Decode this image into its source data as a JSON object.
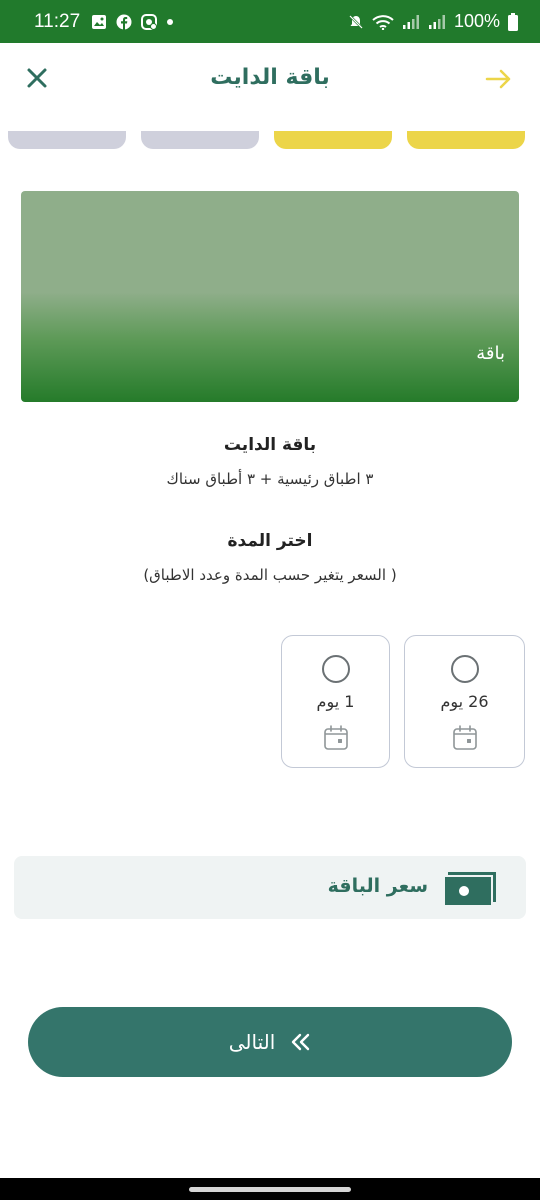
{
  "status_bar": {
    "time": "11:27",
    "battery": "100%"
  },
  "header": {
    "title": "باقة الدايت"
  },
  "progress": {
    "segments": 4,
    "completed": 2,
    "colors": {
      "done": "#ecd549",
      "pending": "#cfd0dc"
    }
  },
  "banner": {
    "label": "باقة"
  },
  "package": {
    "title": "باقة الدايت",
    "description": "٣ اطباق رئيسية + ٣ أطباق سناك"
  },
  "duration": {
    "title": "اختر المدة",
    "note": "( السعر يتغير حسب المدة وعدد الاطباق)",
    "options": [
      {
        "label": "26 يوم",
        "selected": false
      },
      {
        "label": "1 يوم",
        "selected": false
      }
    ]
  },
  "price": {
    "label": "سعر الباقة"
  },
  "footer": {
    "next_label": "التالى"
  },
  "icons": {
    "close": "close-icon",
    "back": "arrow-right-icon",
    "calendar": "calendar-icon",
    "money": "money-icon",
    "next": "double-chevron-left-icon"
  },
  "colors": {
    "status_bar": "#217a2c",
    "primary": "#34756b",
    "title": "#2f6e5f",
    "accent_yellow": "#ecd549"
  }
}
